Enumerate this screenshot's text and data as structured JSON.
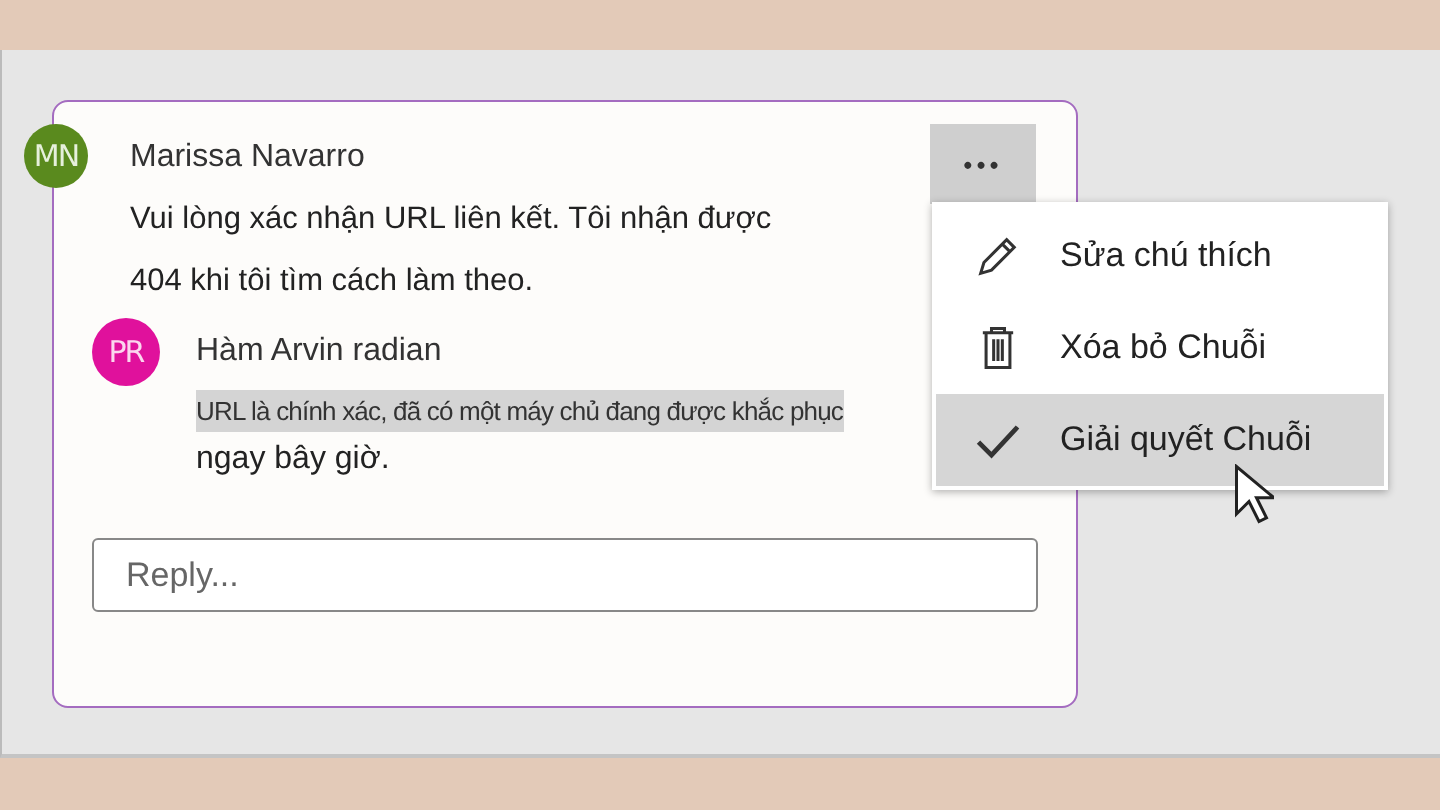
{
  "thread": {
    "comment": {
      "initials": "MN",
      "color": "#5a8a1e",
      "author": "Marissa Navarro",
      "text": "Vui lòng xác nhận URL liên kết. Tôi nhận được 404 khi tôi tìm cách làm theo."
    },
    "more_button": {
      "label": "•••",
      "pressed": true
    },
    "reply": {
      "initials": "PR",
      "color": "#e0119c",
      "author": "Hàm Arvin radian",
      "text_highlighted": "URL là chính xác, đã có một máy chủ đang được khắc phục",
      "text": "ngay bây giờ.",
      "highlighted": true
    },
    "reply_field": {
      "placeholder": "Reply..."
    }
  },
  "menu": {
    "items": [
      {
        "kind": "pencil",
        "label": "Sửa chú thích",
        "selected": false
      },
      {
        "kind": "trash",
        "label": "Xóa bỏ Chuỗi",
        "selected": false
      },
      {
        "kind": "check",
        "label": "Giải quyết Chuỗi",
        "selected": true
      }
    ]
  }
}
